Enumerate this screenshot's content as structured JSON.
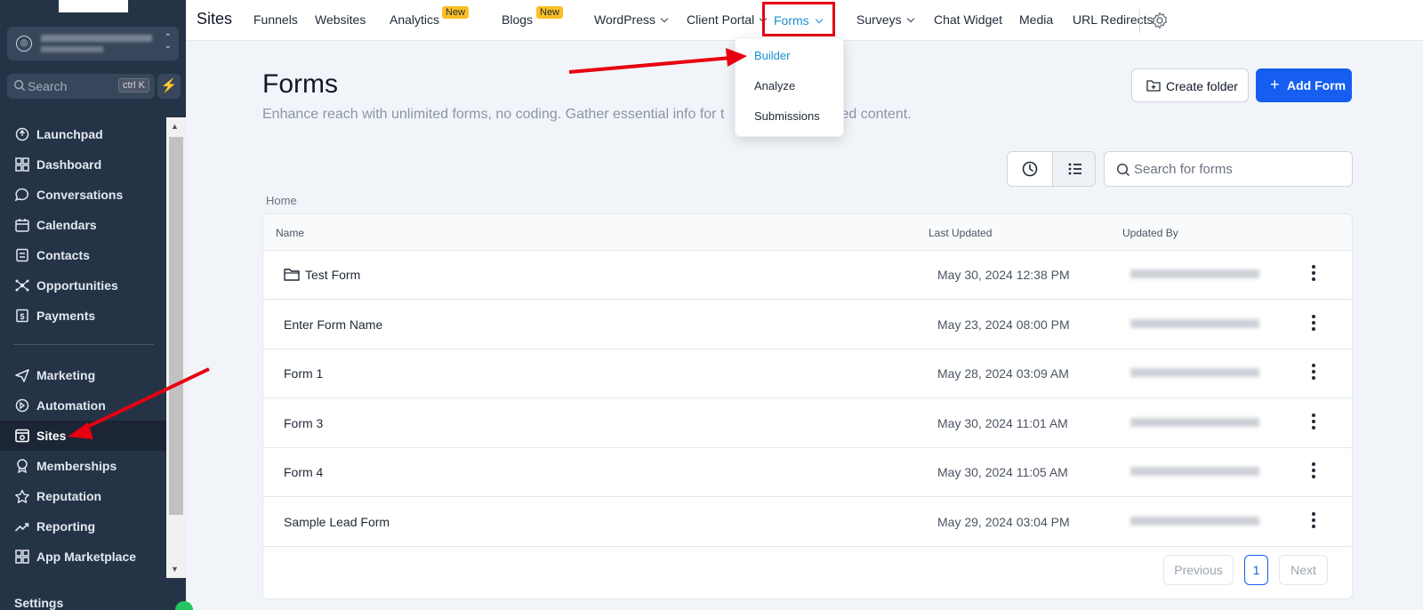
{
  "sidebar": {
    "search": {
      "placeholder": "Search",
      "shortcut": "ctrl K"
    },
    "items_top": [
      {
        "label": "Launchpad",
        "icon": "rocket-icon"
      },
      {
        "label": "Dashboard",
        "icon": "grid-icon"
      },
      {
        "label": "Conversations",
        "icon": "chat-icon"
      },
      {
        "label": "Calendars",
        "icon": "calendar-icon"
      },
      {
        "label": "Contacts",
        "icon": "contacts-icon"
      },
      {
        "label": "Opportunities",
        "icon": "network-icon"
      },
      {
        "label": "Payments",
        "icon": "receipt-icon"
      }
    ],
    "items_bottom": [
      {
        "label": "Marketing",
        "icon": "send-icon"
      },
      {
        "label": "Automation",
        "icon": "automation-icon"
      },
      {
        "label": "Sites",
        "icon": "sites-icon",
        "active": true
      },
      {
        "label": "Memberships",
        "icon": "award-icon"
      },
      {
        "label": "Reputation",
        "icon": "star-icon"
      },
      {
        "label": "Reporting",
        "icon": "trend-icon"
      },
      {
        "label": "App Marketplace",
        "icon": "apps-icon"
      }
    ],
    "settings_label": "Settings"
  },
  "topnav": {
    "brand": "Sites",
    "items": {
      "funnels": "Funnels",
      "websites": "Websites",
      "analytics": "Analytics",
      "blogs": "Blogs",
      "wordpress": "WordPress",
      "client_portal": "Client Portal",
      "forms": "Forms",
      "surveys": "Surveys",
      "chat_widget": "Chat Widget",
      "media": "Media",
      "url_redirects": "URL Redirects"
    },
    "badge_new": "New"
  },
  "forms_dropdown": {
    "items": [
      "Builder",
      "Analyze",
      "Submissions"
    ],
    "selected": "Builder"
  },
  "main": {
    "title": "Forms",
    "subtitle": "Enhance reach with unlimited forms, no coding. Gather essential info for t",
    "subtitle_tail": "lized content.",
    "create_folder": "Create folder",
    "add_form": "Add Form",
    "search_placeholder": "Search for forms",
    "breadcrumb": "Home"
  },
  "table": {
    "columns": {
      "name": "Name",
      "last_updated": "Last Updated",
      "updated_by": "Updated By"
    },
    "rows": [
      {
        "name": "Test Form",
        "is_folder": true,
        "updated": "May 30, 2024 12:38 PM"
      },
      {
        "name": "Enter Form Name",
        "is_folder": false,
        "updated": "May 23, 2024 08:00 PM"
      },
      {
        "name": "Form 1",
        "is_folder": false,
        "updated": "May 28, 2024 03:09 AM"
      },
      {
        "name": "Form 3",
        "is_folder": false,
        "updated": "May 30, 2024 11:01 AM"
      },
      {
        "name": "Form 4",
        "is_folder": false,
        "updated": "May 30, 2024 11:05 AM"
      },
      {
        "name": "Sample Lead Form",
        "is_folder": false,
        "updated": "May 29, 2024 03:04 PM"
      }
    ]
  },
  "pagination": {
    "previous": "Previous",
    "current": "1",
    "next": "Next"
  },
  "colors": {
    "sidebar_bg": "#253347",
    "accent_blue": "#155eef",
    "link_blue": "#1b8fd2",
    "highlight_red": "#e60012",
    "badge_yellow": "#fbbf24"
  }
}
